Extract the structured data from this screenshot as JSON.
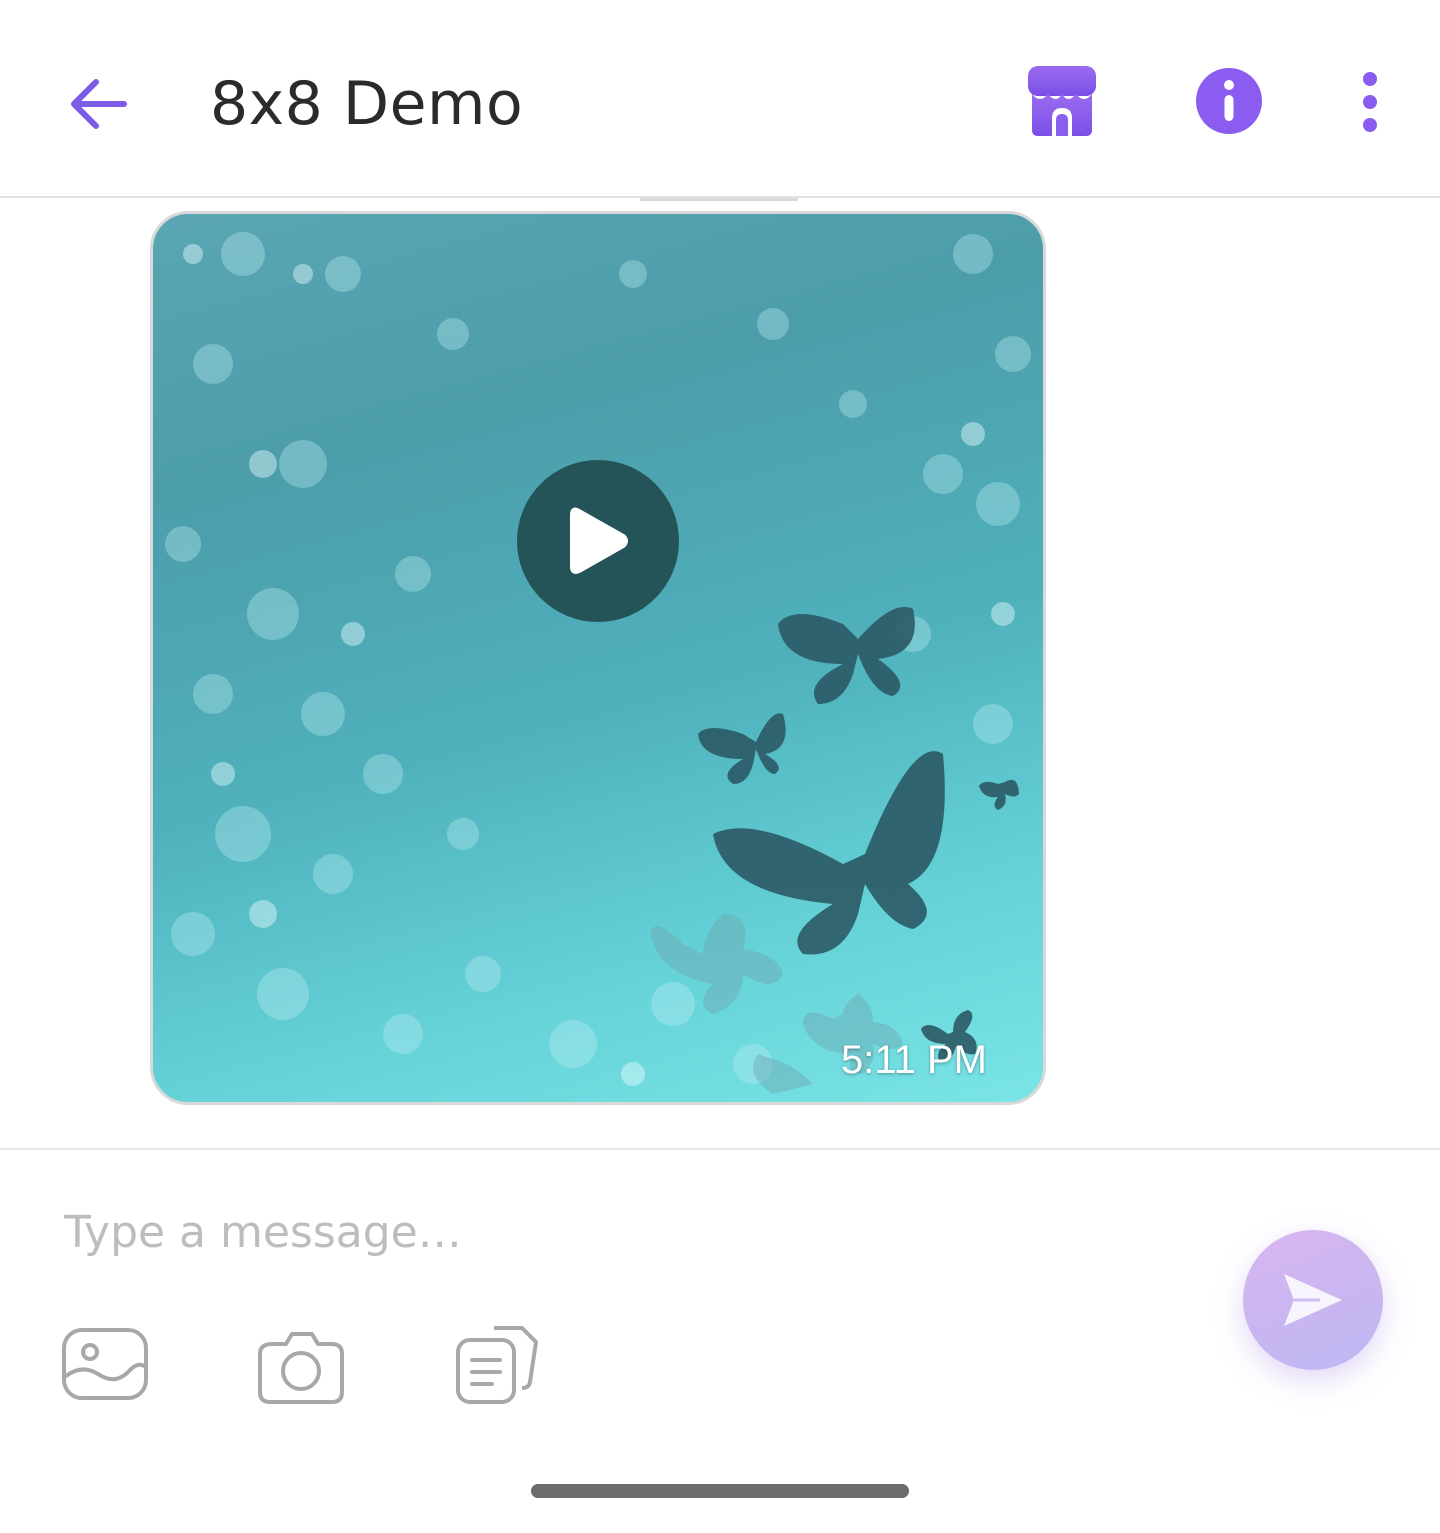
{
  "header": {
    "title": "8x8 Demo",
    "back_icon": "arrow-left-icon",
    "store_icon": "storefront-icon",
    "info_icon": "info-icon",
    "more_icon": "more-vertical-icon",
    "accent_color": "#7b5ce6"
  },
  "message": {
    "type": "video",
    "timestamp": "5:11 PM",
    "play_icon": "play-icon"
  },
  "composer": {
    "placeholder": "Type a message…",
    "value": "",
    "gallery_icon": "gallery-icon",
    "camera_icon": "camera-icon",
    "document_icon": "document-icon",
    "send_icon": "send-icon"
  }
}
